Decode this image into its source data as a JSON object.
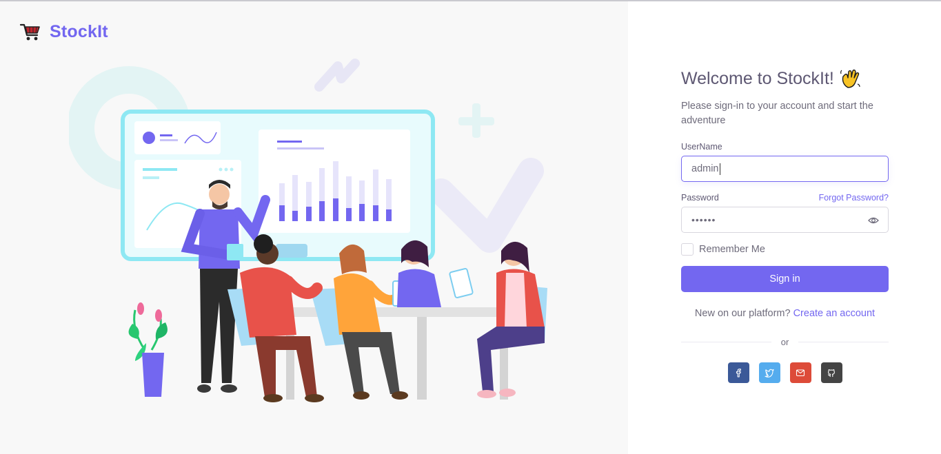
{
  "brand": {
    "name": "StockIt",
    "logo_icon": "shopping-cart-icon",
    "color": "#7367f0"
  },
  "welcome": {
    "title": "Welcome to StockIt!",
    "title_icon": "waving-hand-icon",
    "subtitle": "Please sign-in to your account and start the adventure"
  },
  "form": {
    "username_label": "UserName",
    "username_value": "admin",
    "password_label": "Password",
    "forgot_password": "Forgot Password?",
    "password_value": "••••••",
    "password_toggle_icon": "eye-icon",
    "remember_me": "Remember Me",
    "signin_label": "Sign in"
  },
  "register": {
    "prompt": "New on our platform?",
    "link": "Create an account"
  },
  "divider_text": "or",
  "socials": [
    {
      "name": "facebook",
      "icon": "facebook-icon",
      "color": "#3b5998"
    },
    {
      "name": "twitter",
      "icon": "twitter-icon",
      "color": "#55acee"
    },
    {
      "name": "email",
      "icon": "mail-icon",
      "color": "#dd4b39"
    },
    {
      "name": "github",
      "icon": "github-icon",
      "color": "#444444"
    }
  ],
  "colors": {
    "primary": "#7367f0",
    "heading": "#5e5873",
    "body": "#6e6b7b",
    "left_bg": "#f8f8f8"
  }
}
